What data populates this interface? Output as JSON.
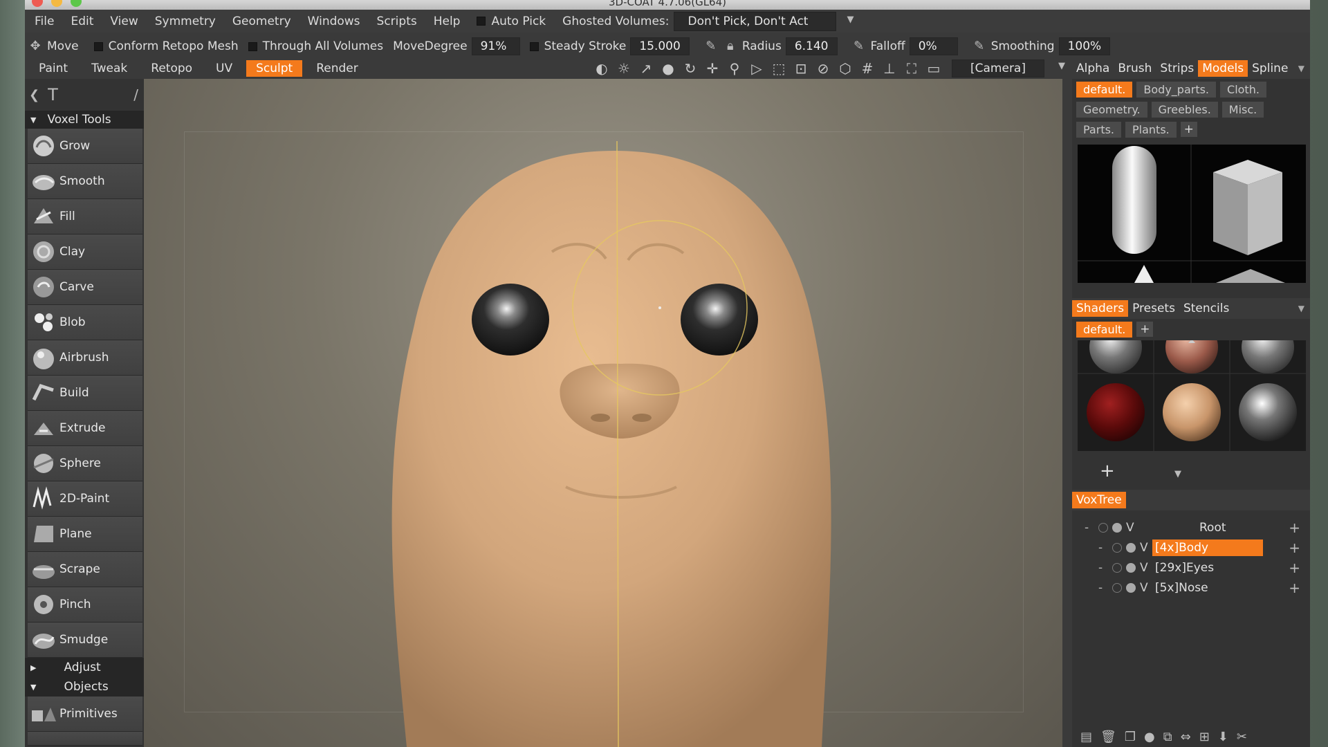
{
  "window": {
    "title": "3D-COAT 4.7.06(GL64)"
  },
  "menubar": {
    "items": [
      "File",
      "Edit",
      "View",
      "Symmetry",
      "Geometry",
      "Windows",
      "Scripts",
      "Help"
    ],
    "auto_pick": "Auto Pick",
    "ghosted_label": "Ghosted Volumes:",
    "ghosted_value": "Don't Pick, Don't Act"
  },
  "toolbar": {
    "move": "Move",
    "conform": "Conform Retopo Mesh",
    "through": "Through All Volumes",
    "move_degree_label": "MoveDegree",
    "move_degree_value": "91%",
    "steady_label": "Steady Stroke",
    "steady_value": "15.000",
    "radius_label": "Radius",
    "radius_value": "6.140",
    "falloff_label": "Falloff",
    "falloff_value": "0%",
    "smoothing_label": "Smoothing",
    "smoothing_value": "100%"
  },
  "rooms": {
    "items": [
      "Paint",
      "Tweak",
      "Retopo",
      "UV",
      "Sculpt",
      "Render"
    ],
    "active": "Sculpt",
    "camera": "[Camera]"
  },
  "left_panel": {
    "voxel_tools_header": "Voxel Tools",
    "tools": [
      "Grow",
      "Smooth",
      "Fill",
      "Clay",
      "Carve",
      "Blob",
      "Airbrush",
      "Build",
      "Extrude",
      "Sphere",
      "2D-Paint",
      "Plane",
      "Scrape",
      "Pinch",
      "Smudge"
    ],
    "adjust": "Adjust",
    "objects": "Objects",
    "primitives": "Primitives"
  },
  "right_panel": {
    "top_tabs": [
      "Alpha",
      "Brush",
      "Strips",
      "Models",
      "Spline"
    ],
    "active_top_tab": "Models",
    "model_chips": [
      "default.",
      "Body_parts.",
      "Cloth.",
      "Geometry.",
      "Greebles.",
      "Misc.",
      "Parts.",
      "Plants."
    ],
    "shader_tabs": [
      "Shaders",
      "Presets",
      "Stencils"
    ],
    "shader_chip": "default.",
    "voxtree_tab": "VoxTree",
    "voxtree": [
      {
        "name": "Root",
        "level": 0
      },
      {
        "name": "[4x]Body",
        "level": 1,
        "active": true
      },
      {
        "name": "[29x]Eyes",
        "level": 1
      },
      {
        "name": "[5x]Nose",
        "level": 1
      }
    ]
  },
  "colors": {
    "accent": "#f47a1c",
    "panel": "#333333",
    "skin": "#d2a67c"
  }
}
